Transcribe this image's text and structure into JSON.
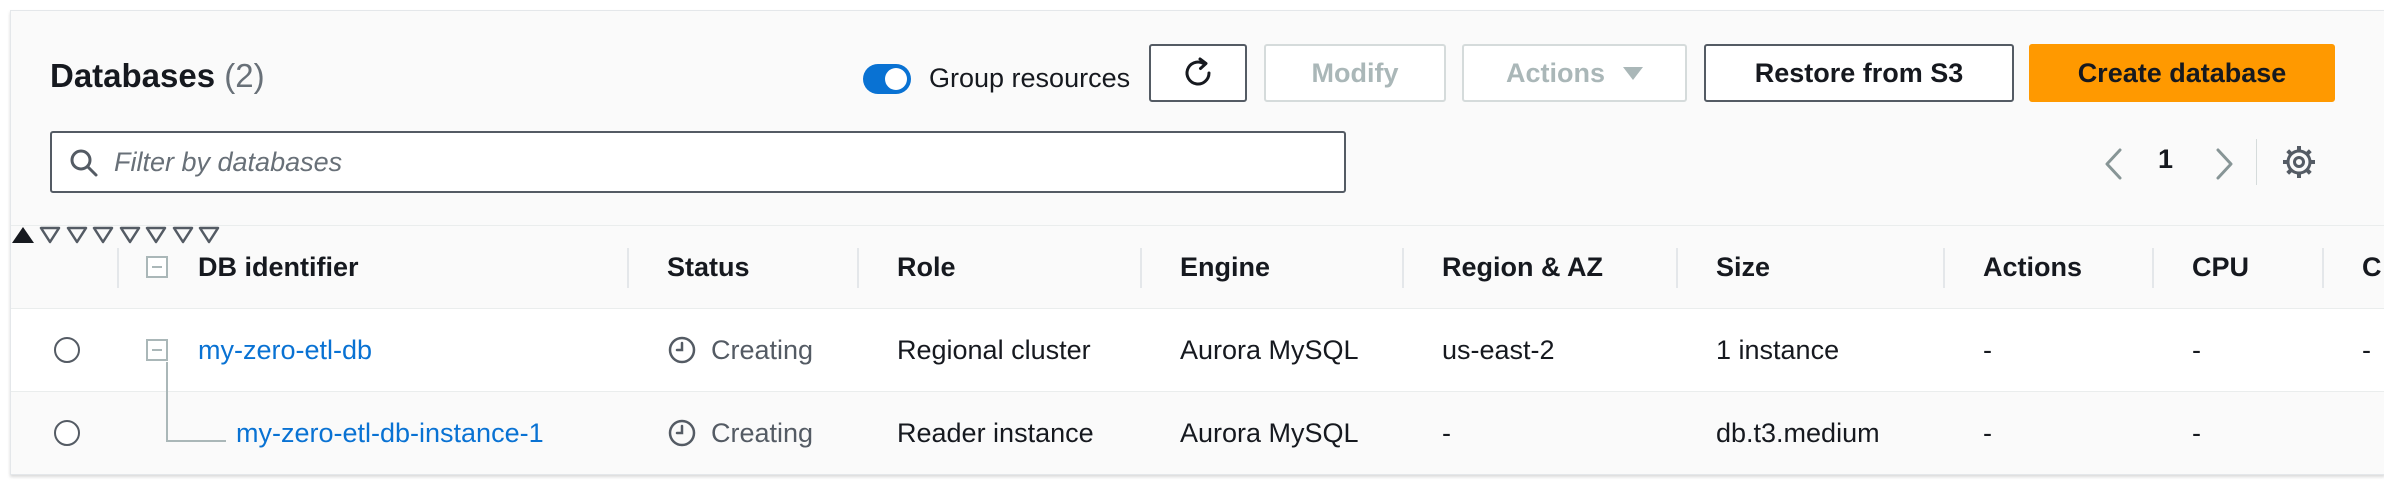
{
  "header": {
    "title": "Databases",
    "count": "(2)",
    "group_resources_label": "Group resources",
    "group_resources_on": true
  },
  "toolbar": {
    "refresh_icon": "refresh-icon",
    "modify_label": "Modify",
    "actions_label": "Actions",
    "restore_label": "Restore from S3",
    "create_label": "Create database"
  },
  "search": {
    "placeholder": "Filter by databases",
    "value": ""
  },
  "pagination": {
    "current_page": "1"
  },
  "columns": [
    {
      "label": "DB identifier",
      "sort": "ascending"
    },
    {
      "label": "Status"
    },
    {
      "label": "Role"
    },
    {
      "label": "Engine"
    },
    {
      "label": "Region & AZ"
    },
    {
      "label": "Size"
    },
    {
      "label": "Actions"
    },
    {
      "label": "CPU"
    }
  ],
  "rows": [
    {
      "identifier": "my-zero-etl-db",
      "status": "Creating",
      "role": "Regional cluster",
      "engine": "Aurora MySQL",
      "region": "us-east-2",
      "size": "1 instance",
      "actions": "-",
      "cpu": "-",
      "next_col": "-"
    },
    {
      "identifier": "my-zero-etl-db-instance-1",
      "status": "Creating",
      "role": "Reader instance",
      "engine": "Aurora MySQL",
      "region": "-",
      "size": "db.t3.medium",
      "actions": "-",
      "cpu": "-"
    }
  ],
  "colors": {
    "accent": "#0972d3",
    "primary_button": "#ff9900",
    "text": "#16191f",
    "muted": "#545b64"
  }
}
